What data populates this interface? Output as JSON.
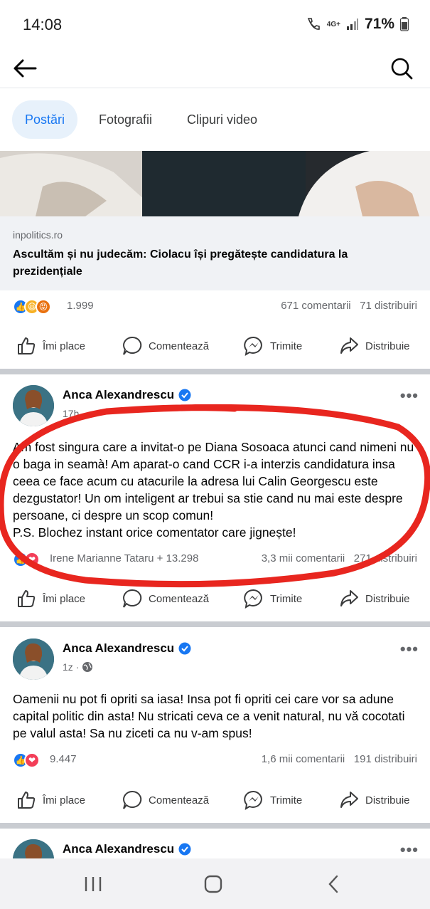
{
  "status_bar": {
    "time": "14:08",
    "network": "4G+",
    "battery": "71%"
  },
  "appbar": {
    "back_icon": "arrow-left-icon",
    "search_icon": "search-icon"
  },
  "tabs": [
    {
      "label": "Postări",
      "active": true
    },
    {
      "label": "Fotografii",
      "active": false
    },
    {
      "label": "Clipuri video",
      "active": false
    }
  ],
  "post1": {
    "link_domain": "inpolitics.ro",
    "link_title": "Ascultăm și nu judecăm: Ciolacu își pregătește candidatura la prezidențiale",
    "reactions_count": "1.999",
    "comments": "671 comentarii",
    "shares": "71 distribuiri"
  },
  "actions": {
    "like": "Îmi place",
    "comment": "Comentează",
    "send": "Trimite",
    "share": "Distribuie"
  },
  "post2": {
    "author": "Anca Alexandrescu",
    "time": "17h",
    "text": "Am fost singura care a invitat-o pe Diana Sosoaca atunci cand nimeni nu o baga in seamà! Am aparat-o cand CCR i-a interzis candidatura insa ceea ce face acum cu atacurile la adresa lui Calin Georgescu este dezgustator! Un om inteligent ar trebui sa stie cand nu mai este despre persoane, ci despre un scop comun!\nP.S. Blochez instant orice comentator care jignește!",
    "reactions_label": "Irene Marianne Tataru + 13.298",
    "comments": "3,3 mii comentarii",
    "shares": "271 distribuiri"
  },
  "post3": {
    "author": "Anca Alexandrescu",
    "time": "1z",
    "text": "Oamenii nu pot fi opriti sa iasa! Insa pot fi opriti cei care vor sa adune capital politic din asta! Nu stricati ceva ce a venit natural, nu vă cocotati pe valul asta! Sa nu ziceti ca nu v-am spus!",
    "reactions_count": "9.447",
    "comments": "1,6 mii comentarii",
    "shares": "191 distribuiri"
  },
  "post4": {
    "author": "Anca Alexandrescu"
  },
  "colors": {
    "accent": "#1877f2",
    "like": "#1877f2",
    "love": "#f33e58",
    "haha": "#f7b125",
    "annotation": "#e8261f"
  }
}
